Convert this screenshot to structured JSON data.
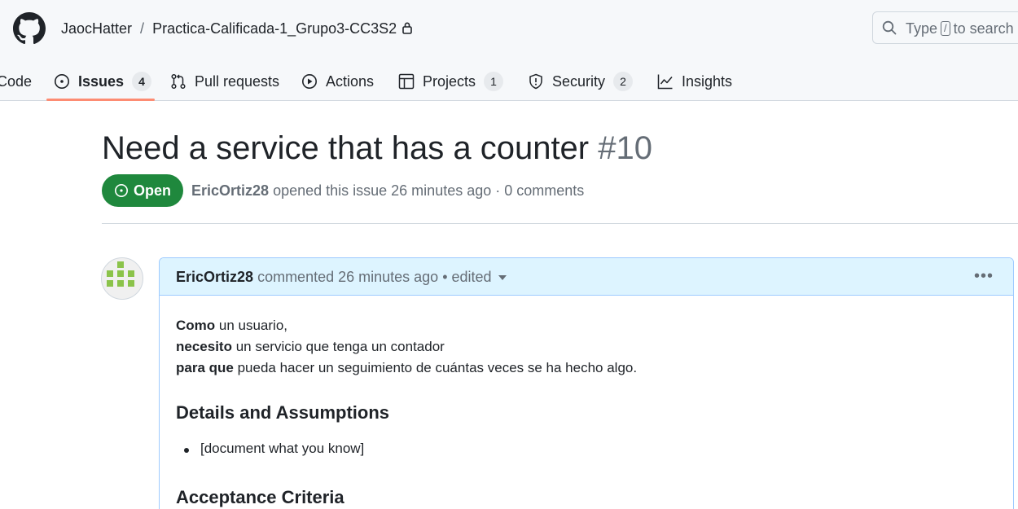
{
  "header": {
    "owner": "JaocHatter",
    "separator": "/",
    "repo": "Practica-Calificada-1_Grupo3-CC3S2",
    "search": {
      "prefix": "Type",
      "key": "/",
      "suffix": "to search"
    }
  },
  "tabs": [
    {
      "label": "Code",
      "icon": "code-icon"
    },
    {
      "label": "Issues",
      "count": "4",
      "icon": "issue-opened-icon",
      "active": true
    },
    {
      "label": "Pull requests",
      "icon": "git-pull-request-icon"
    },
    {
      "label": "Actions",
      "icon": "play-icon"
    },
    {
      "label": "Projects",
      "count": "1",
      "icon": "table-icon"
    },
    {
      "label": "Security",
      "count": "2",
      "icon": "shield-icon"
    },
    {
      "label": "Insights",
      "icon": "graph-icon"
    }
  ],
  "issue": {
    "title": "Need a service that has a counter",
    "number": "#10",
    "state": "Open",
    "author": "EricOrtiz28",
    "meta_rest": "opened this issue 26 minutes ago · 0 comments"
  },
  "comment": {
    "author": "EricOrtiz28",
    "meta": "commented 26 minutes ago • edited",
    "kebab": "•••",
    "lines": [
      {
        "bold": "Como",
        "text": " un usuario,"
      },
      {
        "bold": "necesito",
        "text": " un servicio que tenga un contador"
      },
      {
        "bold": "para que",
        "text": " pueda hacer un seguimiento de cuántas veces se ha hecho algo."
      }
    ],
    "section1": "Details and Assumptions",
    "list_item": "[document what you know]",
    "section2": "Acceptance Criteria"
  },
  "colors": {
    "accent_underline": "#fd8c73",
    "open_green": "#1f883d",
    "comment_header_bg": "#ddf4ff",
    "comment_border": "#9ecbff",
    "avatar_green": "#8bc34a"
  }
}
